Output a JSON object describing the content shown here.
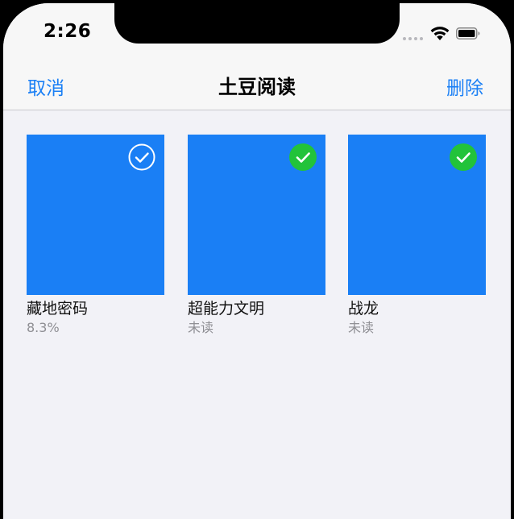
{
  "status_bar": {
    "time": "2:26",
    "signal_icon": "cellular-signal-icon",
    "wifi_icon": "wifi-icon",
    "battery_icon": "battery-icon"
  },
  "nav": {
    "cancel_label": "取消",
    "title": "土豆阅读",
    "delete_label": "删除"
  },
  "colors": {
    "accent": "#1a7ff5",
    "cover": "#1a7ff5",
    "check_selected": "#22c33a",
    "background": "#f2f2f7"
  },
  "books": [
    {
      "title": "藏地密码",
      "status": "8.3%",
      "selected": false,
      "check_icon": "unselected-check-circle-icon"
    },
    {
      "title": "超能力文明",
      "status": "未读",
      "selected": true,
      "check_icon": "selected-check-circle-icon"
    },
    {
      "title": "战龙",
      "status": "未读",
      "selected": true,
      "check_icon": "selected-check-circle-icon"
    }
  ]
}
